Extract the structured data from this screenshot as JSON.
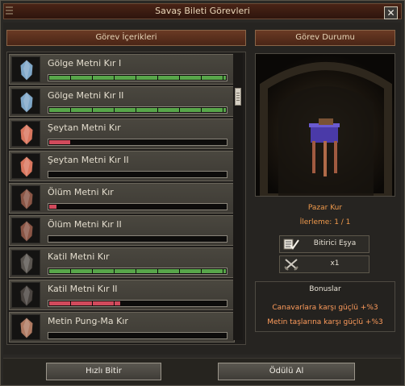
{
  "window": {
    "title": "Savaş Bileti Görevleri",
    "close_glyph": "✕"
  },
  "headers": {
    "left": "Görev İçerikleri",
    "right": "Görev Durumu"
  },
  "quests": [
    {
      "label": "Gölge Metni Kır I",
      "progress": 1.0,
      "bar_color": "#58a64a",
      "stone_color": "#7fa7c8"
    },
    {
      "label": "Gölge Metni Kır II",
      "progress": 1.0,
      "bar_color": "#58a64a",
      "stone_color": "#7fa7c8"
    },
    {
      "label": "Şeytan Metni Kır",
      "progress": 0.12,
      "bar_color": "#d14a5c",
      "stone_color": "#d9765e"
    },
    {
      "label": "Şeytan Metni Kır II",
      "progress": 0.0,
      "bar_color": "#d14a5c",
      "stone_color": "#d9765e"
    },
    {
      "label": "Ölüm Metni Kır",
      "progress": 0.04,
      "bar_color": "#d14a5c",
      "stone_color": "#8a5545"
    },
    {
      "label": "Ölüm Metni Kır II",
      "progress": 0.0,
      "bar_color": "#d14a5c",
      "stone_color": "#8a5545"
    },
    {
      "label": "Katil Metni Kır",
      "progress": 1.0,
      "bar_color": "#58a64a",
      "stone_color": "#5a5550"
    },
    {
      "label": "Katil Metni Kır II",
      "progress": 0.4,
      "bar_color": "#d14a5c",
      "stone_color": "#4a4440"
    },
    {
      "label": "Metin Pung-Ma Kır",
      "progress": 0.0,
      "bar_color": "#d14a5c",
      "stone_color": "#b07a62"
    }
  ],
  "detail": {
    "item_name": "Pazar Kur",
    "progress_text": "İlerleme: 1 / 1",
    "reward_type": "Bitirici Eşya",
    "reward_count": "x1",
    "reward_type_icon": "checklist-icon",
    "reward_count_icon": "crossed-swords-icon"
  },
  "bonuses": {
    "title": "Bonuslar",
    "lines": [
      "Canavarlara karşı güçlü +%3",
      "Metin taşlarına karşı güçlü +%3"
    ]
  },
  "buttons": {
    "finish_fast": "Hızlı Bitir",
    "claim_reward": "Ödülü Al"
  },
  "colors": {
    "accent_orange": "#f09a4c",
    "header_brown": "#5a2f1c",
    "progress_green": "#58a64a",
    "progress_red": "#d14a5c"
  }
}
